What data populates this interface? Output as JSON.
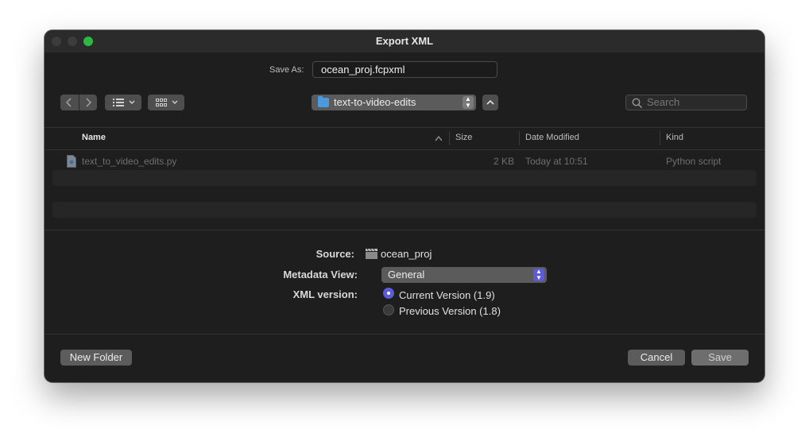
{
  "window": {
    "title": "Export XML"
  },
  "save_as": {
    "label": "Save As:",
    "value": "ocean_proj.fcpxml"
  },
  "toolbar": {
    "back_icon": "chevron-left-icon",
    "forward_icon": "chevron-right-icon",
    "list_view_icon": "list-view-icon",
    "grid_view_icon": "grid-view-icon",
    "location": "text-to-video-edits",
    "search_placeholder": "Search"
  },
  "file_list": {
    "columns": [
      "Name",
      "Size",
      "Date Modified",
      "Kind"
    ],
    "rows": [
      {
        "name": "text_to_video_edits.py",
        "size": "2 KB",
        "date_modified": "Today at 10:51",
        "kind": "Python script"
      }
    ]
  },
  "options": {
    "source_label": "Source:",
    "source_value": "ocean_proj",
    "metadata_label": "Metadata View:",
    "metadata_value": "General",
    "xml_version_label": "XML version:",
    "versions": [
      {
        "label": "Current Version (1.9)",
        "selected": true
      },
      {
        "label": "Previous Version (1.8)",
        "selected": false
      }
    ]
  },
  "buttons": {
    "new_folder": "New Folder",
    "cancel": "Cancel",
    "save": "Save"
  },
  "colors": {
    "accent": "#5b5bd6",
    "folder": "#4a9bde",
    "zoom_button": "#2cb842"
  }
}
